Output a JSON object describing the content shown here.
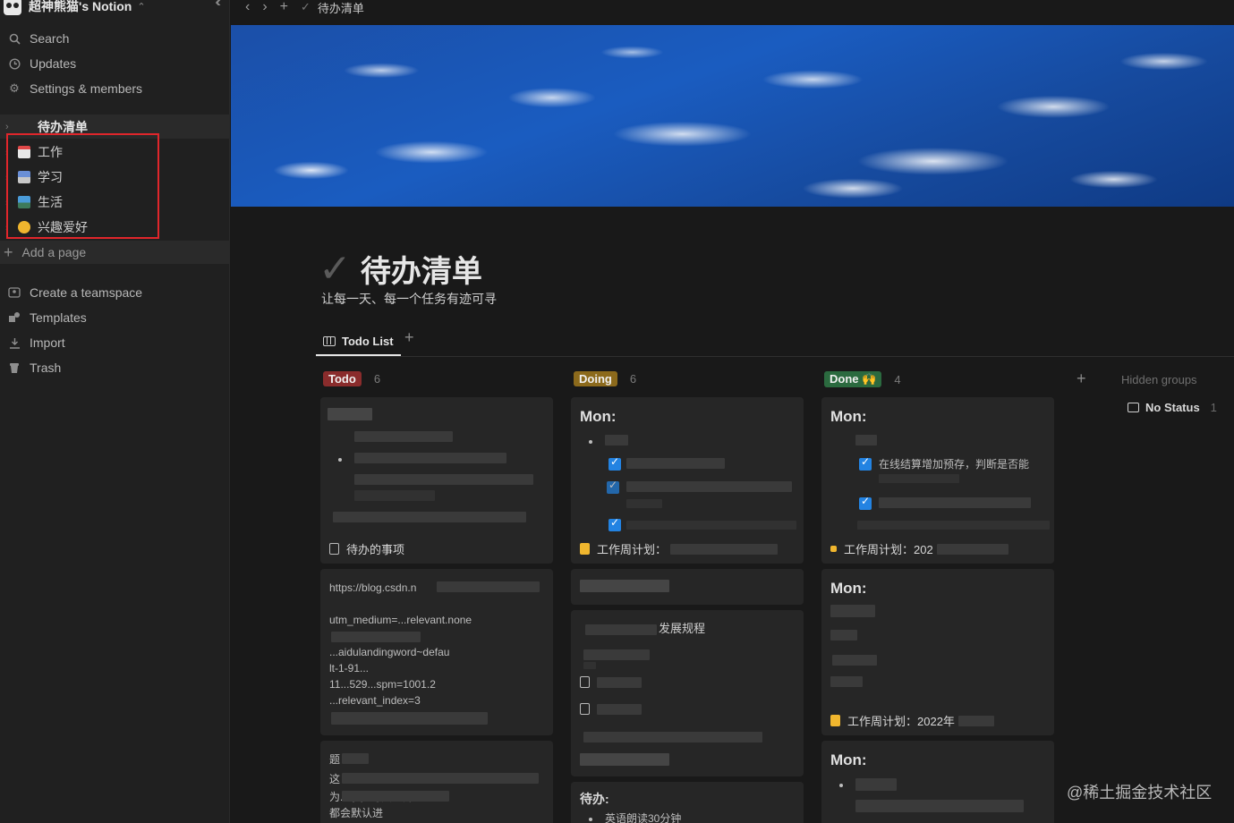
{
  "workspace": {
    "name": "超神熊猫's Notion"
  },
  "sidebar": {
    "nav": [
      {
        "label": "Search",
        "icon": "search-icon"
      },
      {
        "label": "Updates",
        "icon": "clock-icon"
      },
      {
        "label": "Settings & members",
        "icon": "gear-icon"
      }
    ],
    "section_title": "待办清单",
    "subpages": [
      {
        "label": "工作",
        "icon": "calendar-icon",
        "color": "#e04848"
      },
      {
        "label": "学习",
        "icon": "book-icon",
        "color": "#6a8fd6"
      },
      {
        "label": "生活",
        "icon": "landscape-icon",
        "color": "#4a9bd8"
      },
      {
        "label": "兴趣爱好",
        "icon": "smiley-icon",
        "color": "#f0b62e"
      }
    ],
    "add_page": "Add a page",
    "bottom": [
      {
        "label": "Create a teamspace",
        "icon": "teamspace-icon"
      },
      {
        "label": "Templates",
        "icon": "templates-icon"
      },
      {
        "label": "Import",
        "icon": "import-icon"
      },
      {
        "label": "Trash",
        "icon": "trash-icon"
      }
    ]
  },
  "topbar": {
    "breadcrumb": "待办清单"
  },
  "page": {
    "title": "待办清单",
    "description": "让每一天、每一个任务有迹可寻",
    "view_tab": "Todo List"
  },
  "board": {
    "columns": [
      {
        "label": "Todo",
        "count": "6",
        "color": "#8a2c2c"
      },
      {
        "label": "Doing",
        "count": "6",
        "color": "#8c6a1c"
      },
      {
        "label": "Done 🙌",
        "count": "4",
        "color": "#2b6a3f"
      }
    ],
    "hidden_groups": "Hidden groups",
    "no_status": {
      "label": "No Status",
      "count": "1"
    },
    "cards": {
      "todo1_footer": "待办的事项",
      "todo2_lines": [
        "https://blog.csdn.n",
        "utm_medium=...relevant.none",
        "...aidulandingword~defau",
        "lt-1-91...",
        "11...529...spm=1001.2",
        "...relevant_index=3"
      ],
      "todo3_lines": [
        "题",
        "这",
        "为...录，每天打开",
        "都会默认进"
      ],
      "doing1_mon": "Mon:",
      "doing1_footer": "工作周计划：",
      "doing3_line": "发展规程",
      "doing4_head": "待办:",
      "doing4_line": "英语朗读30分钟",
      "done1_mon": "Mon:",
      "done1_line1": "在线结算增加预存，判断是否能",
      "done1_footer": "工作周计划：202",
      "done2_mon": "Mon:",
      "done2_footer": "工作周计划：2022年",
      "done3_mon": "Mon:"
    }
  },
  "watermark": "@稀土掘金技术社区"
}
